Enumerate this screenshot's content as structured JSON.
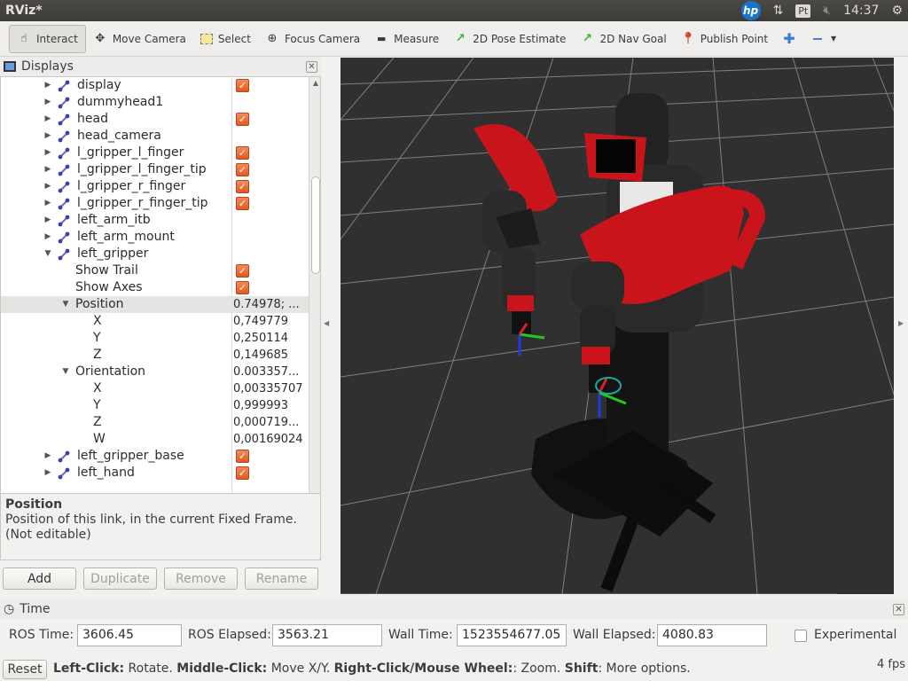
{
  "window": {
    "title": "RViz*",
    "clock": "14:37"
  },
  "toolbar": {
    "interact": "Interact",
    "move_camera": "Move Camera",
    "select": "Select",
    "focus_camera": "Focus Camera",
    "measure": "Measure",
    "pose_estimate": "2D Pose Estimate",
    "nav_goal": "2D Nav Goal",
    "publish_point": "Publish Point"
  },
  "displays": {
    "title": "Displays",
    "rows": [
      {
        "name": "display",
        "checked": true
      },
      {
        "name": "dummyhead1",
        "checked": false
      },
      {
        "name": "head",
        "checked": true
      },
      {
        "name": "head_camera",
        "checked": false
      },
      {
        "name": "l_gripper_l_finger",
        "checked": true
      },
      {
        "name": "l_gripper_l_finger_tip",
        "checked": true
      },
      {
        "name": "l_gripper_r_finger",
        "checked": true
      },
      {
        "name": "l_gripper_r_finger_tip",
        "checked": true
      },
      {
        "name": "left_arm_itb",
        "checked": false
      },
      {
        "name": "left_arm_mount",
        "checked": false
      },
      {
        "name": "left_gripper",
        "checked": false
      }
    ],
    "show_trail": "Show Trail",
    "show_axes": "Show Axes",
    "position": {
      "label": "Position",
      "value": "0.74978; ...",
      "x_label": "X",
      "x": "0,749779",
      "y_label": "Y",
      "y": "0,250114",
      "z_label": "Z",
      "z": "0,149685"
    },
    "orientation": {
      "label": "Orientation",
      "value": "0.003357...",
      "x_label": "X",
      "x": "0,00335707",
      "y_label": "Y",
      "y": "0,999993",
      "z_label": "Z",
      "z": "0,000719...",
      "w_label": "W",
      "w": "0,00169024"
    },
    "tail_rows": [
      "left_gripper_base",
      "left_hand"
    ]
  },
  "description": {
    "title": "Position",
    "text": "Position of this link, in the current Fixed Frame. (Not editable)"
  },
  "buttons": {
    "add": "Add",
    "duplicate": "Duplicate",
    "remove": "Remove",
    "rename": "Rename"
  },
  "time": {
    "title": "Time",
    "ros_time_label": "ROS Time:",
    "ros_time": "3606.45",
    "ros_elapsed_label": "ROS Elapsed:",
    "ros_elapsed": "3563.21",
    "wall_time_label": "Wall Time:",
    "wall_time": "1523554677.05",
    "wall_elapsed_label": "Wall Elapsed:",
    "wall_elapsed": "4080.83",
    "experimental_label": "Experimental"
  },
  "status": {
    "reset": "Reset",
    "left_click": "Left-Click:",
    "left_click_desc": " Rotate. ",
    "middle_click": "Middle-Click:",
    "middle_click_desc": " Move X/Y. ",
    "right_click": "Right-Click/Mouse Wheel:",
    "right_click_desc": ": Zoom. ",
    "shift": "Shift",
    "shift_desc": ": More options.",
    "fps": "4 fps"
  },
  "colors": {
    "accent": "#e8632b",
    "view_bg": "#303030",
    "grid": "#a0a0a0",
    "robot_red": "#c8141a"
  }
}
